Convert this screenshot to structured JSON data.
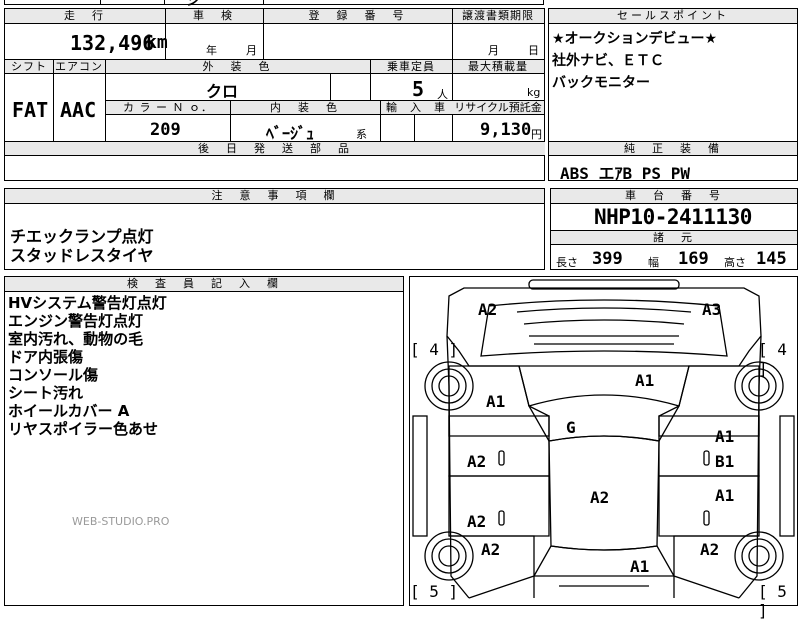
{
  "sheet": {
    "top_partial": {
      "text": "ジ"
    },
    "mileage": {
      "header": "走　行",
      "value": "132,496",
      "unit": "km"
    },
    "shaken": {
      "header": "車　検",
      "year_label": "年",
      "month_label": "月"
    },
    "registration": {
      "header": "登　録　番　号"
    },
    "transfer": {
      "header": "譲渡書類期限",
      "month_label": "月",
      "day_label": "日"
    },
    "shift": {
      "header": "シフト",
      "value": "FAT"
    },
    "aircon": {
      "header": "エアコン",
      "value": "AAC"
    },
    "exterior_color": {
      "header": "外　装　色",
      "value": "クロ"
    },
    "capacity": {
      "header": "乗車定員",
      "value": "5",
      "unit": "人"
    },
    "max_load": {
      "header": "最大積載量",
      "unit": "kg"
    },
    "color_no": {
      "header": "カ ラ ー Ｎ ｏ．",
      "value": "209"
    },
    "interior_color": {
      "header": "内　装　色",
      "value": "ﾍﾞｰｼﾞｭ",
      "suffix": "系"
    },
    "import": {
      "header": "輸　入　車"
    },
    "recycle": {
      "header": "リサイクル預託金",
      "value": "9,130",
      "unit": "円"
    },
    "delivery_parts": {
      "header": "後　日　発　送　部　品"
    },
    "sales_point": {
      "header": "セールスポイント",
      "lines": [
        "★オークションデビュー★",
        "社外ナビ、ＥＴＣ",
        "バックモニター"
      ]
    },
    "genuine_equipment": {
      "header": "純　正　装　備",
      "value": "ABS エｱB PS PW"
    },
    "caution": {
      "header": "注　意　事　項　欄",
      "lines": [
        "チエックランプ点灯",
        "スタッドレスタイヤ"
      ]
    },
    "chassis": {
      "header": "車　台　番　号",
      "value": "NHP10-2411130"
    },
    "dimensions": {
      "header": "諸　元",
      "length_label": "長さ",
      "length": "399",
      "width_label": "幅",
      "width": "169",
      "height_label": "高さ",
      "height": "145"
    },
    "inspector": {
      "header": "検　査　員　記　入　欄",
      "lines": [
        "HVシステム警告灯点灯",
        "エンジン警告灯点灯",
        "室内汚れ、動物の毛",
        "ドア内張傷",
        "コンソール傷",
        "シート汚れ",
        "ホイールカバー A",
        "リヤスポイラー色あせ"
      ]
    },
    "watermark": "WEB-STUDIO.PRO"
  },
  "damage_map": {
    "tire_fl": "[ 4 ]",
    "tire_fr": "[ 4 ]",
    "tire_rl": "[ 5 ]",
    "tire_rr": "[ 5 ]",
    "marks": {
      "front_left_corner": "A2",
      "front_right_corner": "A3",
      "hood": "A1",
      "front_left_fender": "A1",
      "windshield": "G",
      "front_left_door": "A2",
      "front_right_door_a": "A1",
      "front_right_door_b": "B1",
      "roof": "A2",
      "rear_left_door": "A2",
      "rear_right_door": "A1",
      "rear_left_quarter": "A2",
      "rear_right_quarter": "A2",
      "trunk": "A1"
    }
  }
}
